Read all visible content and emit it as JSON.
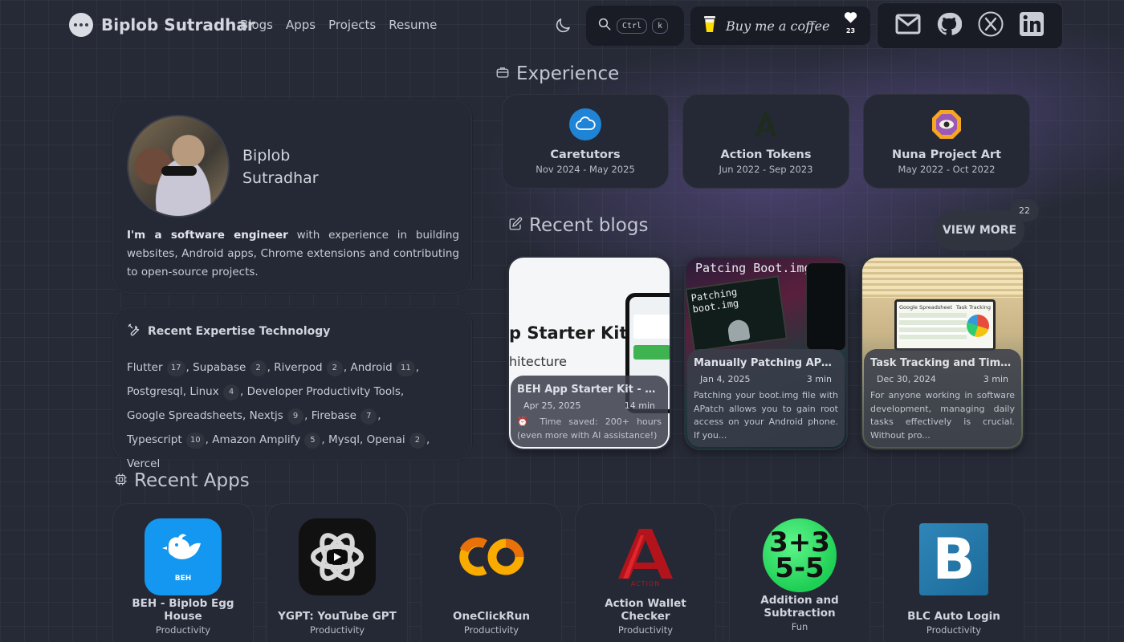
{
  "nav": {
    "brand": "Biplob Sutradhar",
    "links": [
      "Blogs",
      "Apps",
      "Projects",
      "Resume"
    ],
    "search_keys": [
      "Ctrl",
      "k"
    ],
    "coffee_label": "Buy me a coffee",
    "likes": "23",
    "socials": [
      "gmail-icon",
      "github-icon",
      "x-icon",
      "linkedin-icon"
    ]
  },
  "profile": {
    "name_line1": "Biplob",
    "name_line2": "Sutradhar",
    "bio_bold": "I'm a software engineer",
    "bio_rest": " with experience in building websites, Android apps, Chrome extensions and contributing to open-source projects."
  },
  "expertise": {
    "title": "Recent Expertise Technology",
    "items": [
      {
        "name": "Flutter",
        "count": "17"
      },
      {
        "name": "Supabase",
        "count": "2"
      },
      {
        "name": "Riverpod",
        "count": "2"
      },
      {
        "name": "Android",
        "count": "11"
      },
      {
        "name": "Postgresql",
        "count": ""
      },
      {
        "name": "Linux",
        "count": "4"
      },
      {
        "name": "Developer Productivity Tools",
        "count": ""
      },
      {
        "name": "Google Spreadsheets",
        "count": ""
      },
      {
        "name": "Nextjs",
        "count": "9"
      },
      {
        "name": "Firebase",
        "count": "7"
      },
      {
        "name": "Typescript",
        "count": "10"
      },
      {
        "name": "Amazon Amplify",
        "count": "5"
      },
      {
        "name": "Mysql",
        "count": ""
      },
      {
        "name": "Openai",
        "count": "2"
      },
      {
        "name": "Vercel",
        "count": ""
      }
    ]
  },
  "experience": {
    "heading": "Experience",
    "items": [
      {
        "name": "Caretutors",
        "dates": "Nov 2024 - May 2025"
      },
      {
        "name": "Action Tokens",
        "dates": "Jun 2022 - Sep 2023"
      },
      {
        "name": "Nuna Project Art",
        "dates": "May 2022 - Oct 2022"
      }
    ]
  },
  "blogs": {
    "heading": "Recent blogs",
    "view_more": "VIEW MORE",
    "count": "22",
    "items": [
      {
        "title": "BEH App Starter Kit - Buil...",
        "date": "Apr 25, 2025",
        "read": "14 min",
        "excerpt": "⏰ Time saved: 200+ hours (even more with AI assistance!)",
        "img_text": "p Starter Kit",
        "img_sub": "hitecture"
      },
      {
        "title": "Manually Patching APatch ...",
        "date": "Jan 4, 2025",
        "read": "3 min",
        "excerpt": "Patching your boot.img file with APatch allows you to gain root access on your Android phone. If you...",
        "img_text": "Patching boot.img",
        "img_sub": "Patcing Boot.img"
      },
      {
        "title": "Task Tracking and Time Ma...",
        "date": "Dec 30, 2024",
        "read": "3 min",
        "excerpt": "For anyone working in software development, managing daily tasks effectively is crucial. Without pro...",
        "img_text": "Google Spreadsheet",
        "img_sub": "Task Tracking"
      }
    ]
  },
  "apps": {
    "heading": "Recent Apps",
    "items": [
      {
        "name": "BEH - Biplob Egg House",
        "category": "Productivity",
        "icon_text": "BEH"
      },
      {
        "name": "YGPT: YouTube GPT",
        "category": "Productivity",
        "icon_text": ""
      },
      {
        "name": "OneClickRun",
        "category": "Productivity",
        "icon_text": "CO"
      },
      {
        "name": "Action Wallet Checker",
        "category": "Productivity",
        "icon_text": "ACTION"
      },
      {
        "name": "Addition and Subtraction",
        "category": "Fun",
        "icon_text_1": "3+3",
        "icon_text_2": "5-5"
      },
      {
        "name": "BLC Auto Login",
        "category": "Productivity",
        "icon_text": "B"
      }
    ]
  }
}
